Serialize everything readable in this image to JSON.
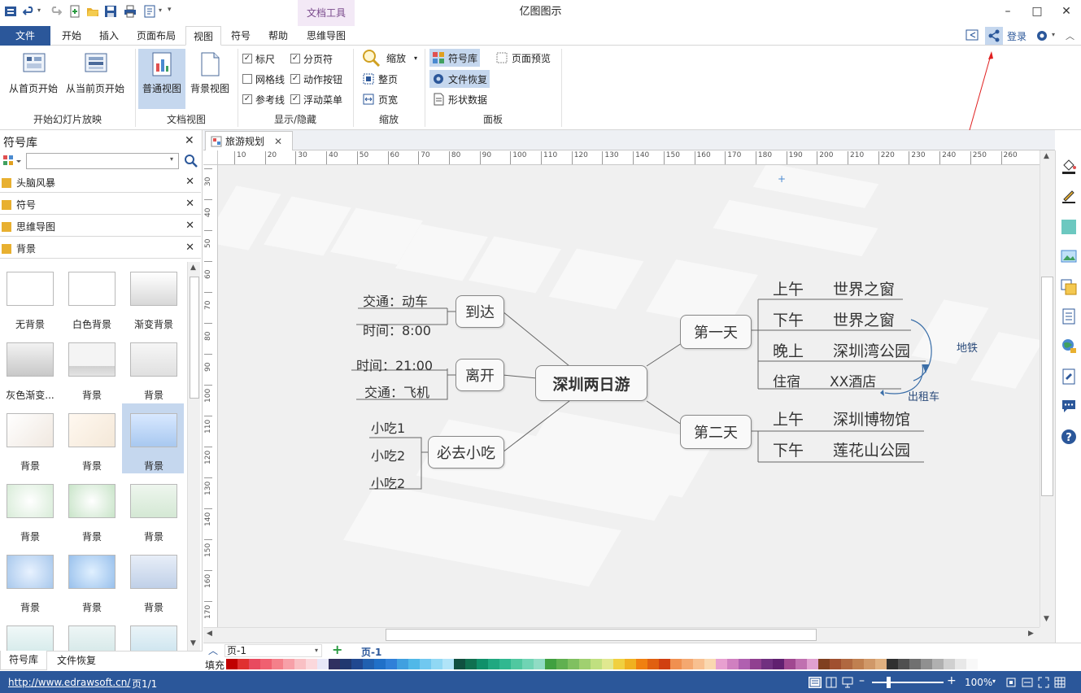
{
  "window": {
    "title": "亿图图示",
    "context_tab": "文档工具",
    "minimize": "–",
    "maximize": "□",
    "close": "✕"
  },
  "tabs": {
    "file": "文件",
    "items": [
      "开始",
      "插入",
      "页面布局",
      "视图",
      "符号",
      "帮助",
      "思维导图"
    ]
  },
  "account": {
    "login": "登录"
  },
  "ribbon": {
    "slideshow": {
      "from_first": "从首页开始",
      "from_current": "从当前页开始",
      "group": "开始幻灯片放映"
    },
    "docview": {
      "normal": "普通视图",
      "background": "背景视图",
      "group": "文档视图"
    },
    "showhide": {
      "ruler": "标尺",
      "pagebreak": "分页符",
      "grid": "网格线",
      "action_btn": "动作按钮",
      "guide": "参考线",
      "float_menu": "浮动菜单",
      "group": "显示/隐藏"
    },
    "zoom": {
      "zoom": "缩放",
      "whole_page": "整页",
      "page_width": "页宽",
      "group": "缩放"
    },
    "panel": {
      "library": "符号库",
      "page_preview": "页面预览",
      "file_recovery": "文件恢复",
      "shape_data": "形状数据",
      "group": "面板"
    }
  },
  "library": {
    "title": "符号库",
    "search_placeholder": "",
    "categories": [
      "头脑风暴",
      "符号",
      "思维导图",
      "背景"
    ],
    "thumbs": [
      "无背景",
      "白色背景",
      "渐变背景",
      "灰色渐变...",
      "背景",
      "背景",
      "背景",
      "背景",
      "背景",
      "背景",
      "背景",
      "背景",
      "背景",
      "背景",
      "背景"
    ],
    "bottom_tabs": [
      "符号库",
      "文件恢复"
    ]
  },
  "document": {
    "tab_name": "旅游规划",
    "ruler_h": [
      "10",
      "20",
      "30",
      "40",
      "50",
      "60",
      "70",
      "80",
      "90",
      "100",
      "110",
      "120",
      "130",
      "140",
      "150",
      "160",
      "170",
      "180",
      "190",
      "200",
      "210",
      "220",
      "230",
      "240",
      "250",
      "260"
    ],
    "ruler_v": [
      "30",
      "40",
      "50",
      "60",
      "70",
      "80",
      "90",
      "100",
      "110",
      "120",
      "130",
      "140",
      "150",
      "160",
      "170"
    ]
  },
  "mindmap": {
    "center": "深圳两日游",
    "arrive": "到达",
    "arrive_transport": "交通：动车",
    "arrive_time": "时间：8:00",
    "leave": "离开",
    "leave_time": "时间：21:00",
    "leave_transport": "交通：飞机",
    "snacks": "必去小吃",
    "snack1": "小吃1",
    "snack2": "小吃2",
    "snack3": "小吃2",
    "day1": "第一天",
    "d1_am": "上午",
    "d1_am_place": "世界之窗",
    "d1_pm": "下午",
    "d1_pm_place": "世界之窗",
    "d1_eve": "晚上",
    "d1_eve_place": "深圳湾公园",
    "d1_stay": "住宿",
    "d1_stay_place": "XX酒店",
    "metro": "地铁",
    "taxi": "出租车",
    "day2": "第二天",
    "d2_am": "上午",
    "d2_am_place": "深圳博物馆",
    "d2_pm": "下午",
    "d2_pm_place": "莲花山公园"
  },
  "pagebar": {
    "page_select": "页-1",
    "page_tab": "页-1",
    "fill_label": "填充"
  },
  "status": {
    "url": "http://www.edrawsoft.cn/",
    "page": "页1/1",
    "zoom": "100%"
  },
  "colors": {
    "accent": "#2b579a",
    "palette": [
      "#c00000",
      "#e03030",
      "#e84a5f",
      "#f06070",
      "#f4808a",
      "#f7a0a8",
      "#f9c0c4",
      "#fbd8dc",
      "#e8e8f8",
      "#303060",
      "#203870",
      "#204890",
      "#2060b0",
      "#2070c8",
      "#3080d8",
      "#40a0e0",
      "#50b8e8",
      "#70c8f0",
      "#90d8f4",
      "#b0e4f8",
      "#105040",
      "#107050",
      "#10906a",
      "#20a880",
      "#30b890",
      "#50c8a0",
      "#70d4b4",
      "#90dcc4",
      "#40a040",
      "#60b050",
      "#80c060",
      "#a0d070",
      "#c0e080",
      "#e0e890",
      "#f0d040",
      "#f0b020",
      "#f08010",
      "#e06010",
      "#d04010",
      "#f09050",
      "#f4a870",
      "#f8c090",
      "#fad8b0",
      "#e8a0d0",
      "#d080c0",
      "#b060b0",
      "#904090",
      "#703080",
      "#602070",
      "#a04890",
      "#c070b0",
      "#e0a0d0",
      "#804020",
      "#a05030",
      "#b06840",
      "#c08050",
      "#d09868",
      "#e0b080",
      "#303030",
      "#505050",
      "#707070",
      "#909090",
      "#b0b0b0",
      "#d0d0d0",
      "#e8e8e8",
      "#f8f8f8"
    ]
  }
}
